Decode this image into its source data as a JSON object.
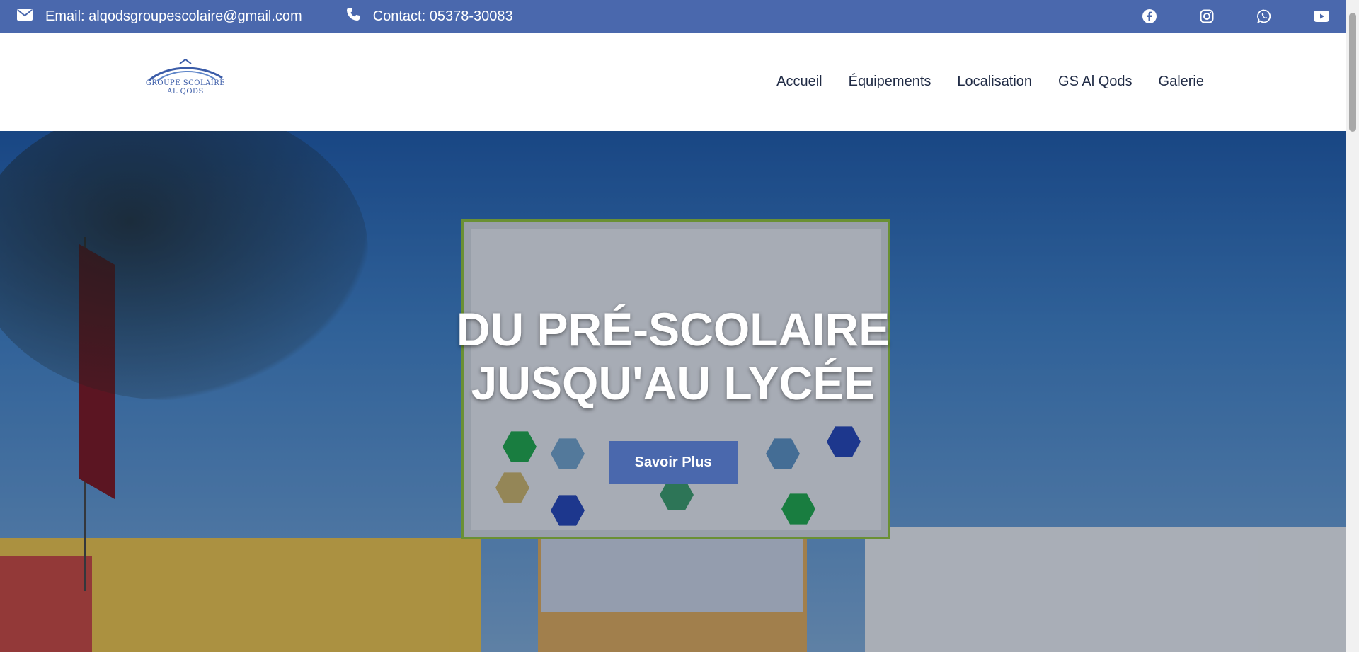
{
  "topbar": {
    "email_label": "Email: alqodsgroupescolaire@gmail.com",
    "contact_label": "Contact: 05378-30083",
    "socials": [
      {
        "icon": "facebook-icon"
      },
      {
        "icon": "instagram-icon"
      },
      {
        "icon": "whatsapp-icon"
      },
      {
        "icon": "youtube-icon"
      }
    ],
    "color": "#4a68ad"
  },
  "header": {
    "logo_line1": "GROUPE SCOLAIRE",
    "logo_line2": "AL QODS",
    "nav": [
      {
        "label": "Accueil"
      },
      {
        "label": "Équipements"
      },
      {
        "label": "Localisation"
      },
      {
        "label": "GS Al Qods"
      },
      {
        "label": "Galerie"
      }
    ]
  },
  "hero": {
    "title_line1": "DU PRÉ-SCOLAIRE",
    "title_line2": "JUSQU'AU LYCÉE",
    "cta_label": "Savoir Plus"
  }
}
